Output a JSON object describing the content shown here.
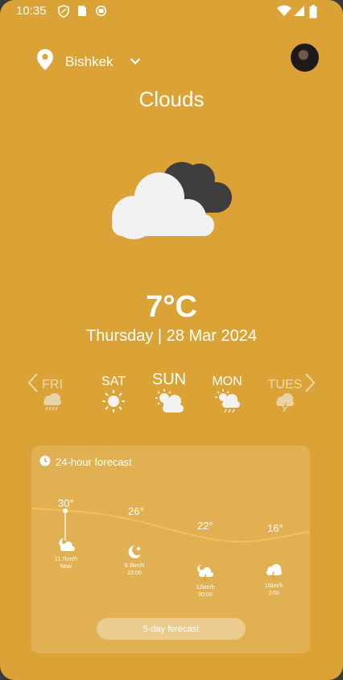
{
  "status": {
    "time": "10:35"
  },
  "location": {
    "city": "Bishkek"
  },
  "weather": {
    "condition": "Clouds",
    "temperature": "7°C",
    "date": "Thursday | 28 Mar 2024"
  },
  "days": [
    {
      "label": "FRI",
      "icon": "rain-cloud-icon"
    },
    {
      "label": "SAT",
      "icon": "sun-icon"
    },
    {
      "label": "SUN",
      "icon": "sun-cloud-icon"
    },
    {
      "label": "MON",
      "icon": "sun-rain-icon"
    },
    {
      "label": "TUES",
      "icon": "thunder-cloud-icon"
    }
  ],
  "forecast": {
    "title": "24-hour forecast",
    "button": "5-day forecast",
    "hours": [
      {
        "temp": "30°",
        "wind": "11.7km/h",
        "time": "Now",
        "icon": "night-cloud-icon"
      },
      {
        "temp": "26°",
        "wind": "9.3km/h",
        "time": "22:00",
        "icon": "moon-icon"
      },
      {
        "temp": "22°",
        "wind": "12km/h",
        "time": "00:00",
        "icon": "night-rain-icon"
      },
      {
        "temp": "16°",
        "wind": "15km/h",
        "time": "2:00",
        "icon": "rain-cloud-icon"
      }
    ]
  },
  "colors": {
    "background": "#dba336",
    "curve": "#f2c25a"
  }
}
